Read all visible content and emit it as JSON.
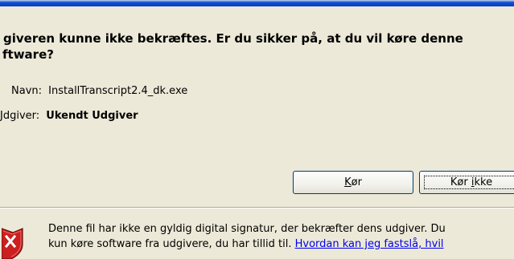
{
  "dialog": {
    "heading_line1": "giveren kunne ikke bekræftes.  Er du sikker på, at du vil køre denne",
    "heading_line2": "ftware?"
  },
  "fields": {
    "name_label": "Navn:",
    "name_value": "InstallTranscript2.4_dk.exe",
    "publisher_label": "Jdgiver:",
    "publisher_value": "Ukendt Udgiver"
  },
  "buttons": {
    "run_prefix": "",
    "run_access": "K",
    "run_suffix": "ør",
    "dont_run_prefix": "Kør ",
    "dont_run_access": "i",
    "dont_run_suffix": "kke"
  },
  "warning": {
    "line1": "Denne fil har ikke en gyldig digital signatur, der bekræfter dens udgiver. Du",
    "line2_text": "kun køre software fra udgivere, du har tillid til. ",
    "help_link": "Hvordan kan jeg fastslå, hvil"
  },
  "icons": {
    "shield": "shield-warning-icon"
  },
  "colors": {
    "dialog_background": "#ece9d8",
    "title_bar": "#0a3cbf",
    "button_border": "#003c74",
    "link": "#0000ee",
    "shield_red": "#cc1f1f"
  }
}
